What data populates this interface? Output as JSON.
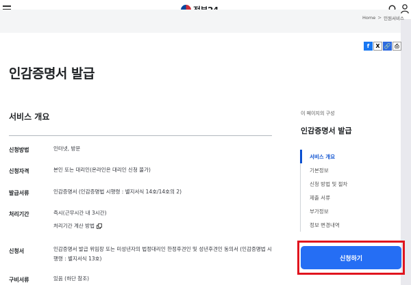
{
  "header": {
    "logo_text": "정부24",
    "menu_icon": "hamburger-icon",
    "search_icon": "search-icon",
    "user_icon": "user-icon"
  },
  "breadcrumb": {
    "home": "Home",
    "separator": ">",
    "current": "민원서비스"
  },
  "share": {
    "facebook": "f",
    "x": "X",
    "link": "🔗",
    "print": "⎙"
  },
  "main": {
    "title": "인감증명서 발급",
    "section_title": "서비스 개요",
    "rows": [
      {
        "label": "신청방법",
        "value": "인터넷, 방문"
      },
      {
        "label": "신청자격",
        "value": "본인 또는 대리인(온라인은 대리인 신청 불가)"
      },
      {
        "label": "발급서류",
        "value": "인감증명서 (인감증명법 시행령 : 별지서식 14호/14호의 2)"
      },
      {
        "label": "처리기간",
        "value": "즉시(근무시간 내 3시간)",
        "link": "처리기간 계산 방법"
      },
      {
        "label": "신청서",
        "value": "인감증명서 발급 위임장 또는 미성년자의 법정대리인 한정후견인 및 성년후견인 동의서 (인감증명법 시행령 : 별지서식 13호)"
      },
      {
        "label": "구비서류",
        "value": "있음 (하단 참조)"
      }
    ]
  },
  "toc": {
    "caption": "이 페이지의 구성",
    "title": "인감증명서 발급",
    "items": [
      "서비스 개요",
      "기본정보",
      "신청 방법 및 절차",
      "제출 서류",
      "부가정보",
      "정보 변경내역"
    ]
  },
  "apply_button": {
    "label": "신청하기"
  },
  "colors": {
    "accent": "#256ef4",
    "highlight": "#e0141e",
    "active": "#0b50d0"
  }
}
